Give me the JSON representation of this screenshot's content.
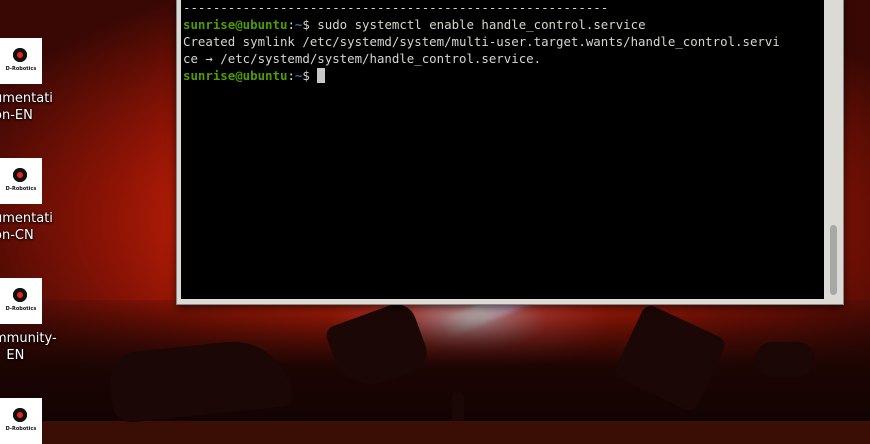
{
  "desktop": {
    "icons": [
      {
        "brand": "D-Robotics",
        "label": "umentati\non-EN"
      },
      {
        "brand": "D-Robotics",
        "label": "umentati\non-CN"
      },
      {
        "brand": "D-Robotics",
        "label": "mmunity-\n   EN"
      },
      {
        "brand": "D-Robotics",
        "label": ""
      }
    ]
  },
  "terminal": {
    "separator": "---------------------------------------------------------",
    "lines": [
      {
        "user": "sunrise@ubuntu",
        "path": "~",
        "symbol": "$",
        "command": " sudo systemctl enable handle_control.service"
      },
      {
        "output": "Created symlink /etc/systemd/system/multi-user.target.wants/handle_control.servi"
      },
      {
        "output": "ce → /etc/systemd/system/handle_control.service."
      },
      {
        "user": "sunrise@ubuntu",
        "path": "~",
        "symbol": "$",
        "command": " "
      }
    ]
  },
  "colors": {
    "prompt_user": "#4e9a06",
    "prompt_path": "#3465a4",
    "terminal_bg": "#000000"
  }
}
